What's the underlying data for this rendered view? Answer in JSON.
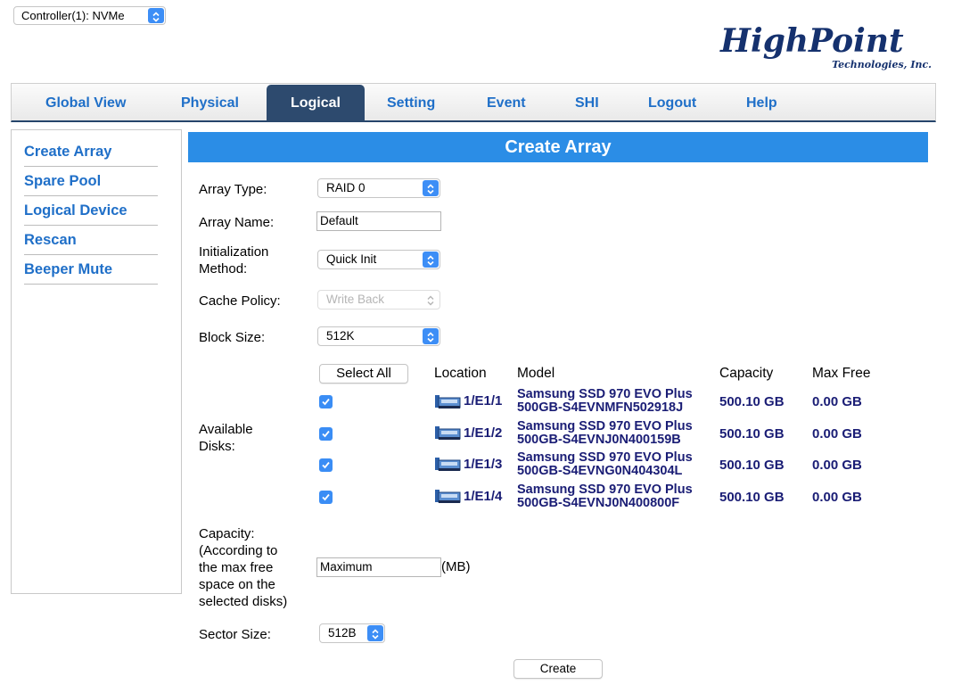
{
  "controller_select": {
    "value": "Controller(1): NVMe"
  },
  "logo": {
    "brand": "HighPoint",
    "subtitle": "Technologies, Inc."
  },
  "nav": {
    "tabs": [
      {
        "label": "Global View"
      },
      {
        "label": "Physical"
      },
      {
        "label": "Logical",
        "active": true
      },
      {
        "label": "Setting"
      },
      {
        "label": "Event"
      },
      {
        "label": "SHI"
      },
      {
        "label": "Logout"
      },
      {
        "label": "Help"
      }
    ]
  },
  "sidebar": {
    "items": [
      {
        "label": "Create Array"
      },
      {
        "label": "Spare Pool"
      },
      {
        "label": "Logical Device"
      },
      {
        "label": "Rescan"
      },
      {
        "label": "Beeper Mute"
      }
    ]
  },
  "form": {
    "header": "Create Array",
    "array_type": {
      "label": "Array Type:",
      "value": "RAID 0"
    },
    "array_name": {
      "label": "Array Name:",
      "value": "Default"
    },
    "init_method": {
      "label_line1": "Initialization",
      "label_line2": "Method:",
      "value": "Quick Init"
    },
    "cache_policy": {
      "label": "Cache Policy:",
      "value": "Write Back"
    },
    "block_size": {
      "label": "Block Size:",
      "value": "512K"
    },
    "available_disks": {
      "label_line1": "Available",
      "label_line2": "Disks:"
    },
    "select_all_label": "Select All",
    "columns": {
      "location": "Location",
      "model": "Model",
      "capacity": "Capacity",
      "max_free": "Max Free"
    },
    "disks": [
      {
        "location": "1/E1/1",
        "model_line1": "Samsung SSD 970 EVO Plus",
        "model_line2": "500GB-S4EVNMFN502918J",
        "capacity": "500.10 GB",
        "max_free": "0.00 GB",
        "checked": true
      },
      {
        "location": "1/E1/2",
        "model_line1": "Samsung SSD 970 EVO Plus",
        "model_line2": "500GB-S4EVNJ0N400159B",
        "capacity": "500.10 GB",
        "max_free": "0.00 GB",
        "checked": true
      },
      {
        "location": "1/E1/3",
        "model_line1": "Samsung SSD 970 EVO Plus",
        "model_line2": "500GB-S4EVNG0N404304L",
        "capacity": "500.10 GB",
        "max_free": "0.00 GB",
        "checked": true
      },
      {
        "location": "1/E1/4",
        "model_line1": "Samsung SSD 970 EVO Plus",
        "model_line2": "500GB-S4EVNJ0N400800F",
        "capacity": "500.10 GB",
        "max_free": "0.00 GB",
        "checked": true
      }
    ],
    "capacity": {
      "label_lines": [
        "Capacity:",
        "(According to",
        "the max free",
        "space on the",
        "selected disks)"
      ],
      "value": "Maximum",
      "unit": "(MB)"
    },
    "sector_size": {
      "label": "Sector Size:",
      "value": "512B"
    },
    "create_label": "Create"
  },
  "colors": {
    "accent": "#2b8de6",
    "nav_active": "#2d4a6e",
    "link": "#1f6fc8",
    "disk_text": "#1a1d75"
  }
}
